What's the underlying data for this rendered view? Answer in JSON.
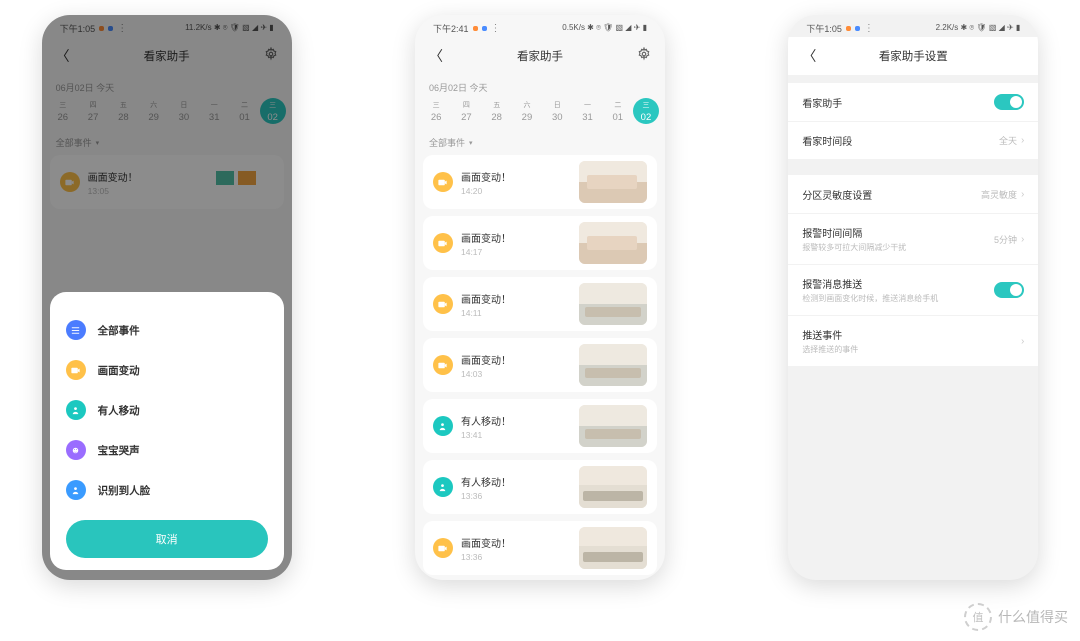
{
  "status": {
    "time_left": "下午1:05",
    "time_left2": "下午2:41",
    "net1": "11.2K/s ✱ ⌾ 🛡 ▧ ◢ ✈ ▮",
    "net2": "0.5K/s ✱ ⌾ 🛡 ▧ ◢ ✈ ▮",
    "net3": "2.2K/s ✱ ⌾ 🛡 ▧ ◢ ✈ ▮"
  },
  "titles": {
    "main": "看家助手",
    "settings": "看家助手设置"
  },
  "date": {
    "label": "06月02日 今天",
    "weekdays": [
      "三",
      "四",
      "五",
      "六",
      "日",
      "一",
      "二",
      "三"
    ],
    "days": [
      "26",
      "27",
      "28",
      "29",
      "30",
      "31",
      "01",
      "02"
    ]
  },
  "filter_label": "全部事件",
  "filter_options": {
    "all": "全部事件",
    "change": "画面变动",
    "person": "有人移动",
    "baby": "宝宝哭声",
    "face": "识别到人脸"
  },
  "cancel_label": "取消",
  "screen1_event": {
    "title": "画面变动！",
    "time": "13:05"
  },
  "events": [
    {
      "title": "画面变动！",
      "time": "14:20",
      "icon": "yellow",
      "thumb": "a"
    },
    {
      "title": "画面变动！",
      "time": "14:17",
      "icon": "yellow",
      "thumb": "a"
    },
    {
      "title": "画面变动！",
      "time": "14:11",
      "icon": "yellow",
      "thumb": "b"
    },
    {
      "title": "画面变动！",
      "time": "14:03",
      "icon": "yellow",
      "thumb": "b"
    },
    {
      "title": "有人移动！",
      "time": "13:41",
      "icon": "teal",
      "thumb": "b"
    },
    {
      "title": "有人移动！",
      "time": "13:36",
      "icon": "teal",
      "thumb": "c"
    },
    {
      "title": "画面变动！",
      "time": "13:36",
      "icon": "yellow",
      "thumb": "c"
    }
  ],
  "settings": {
    "enable": {
      "label": "看家助手"
    },
    "period": {
      "label": "看家时间段",
      "value": "全天"
    },
    "sensitivity": {
      "label": "分区灵敏度设置",
      "value": "高灵敏度"
    },
    "interval": {
      "label": "报警时间间隔",
      "sub": "报警较多可拉大间隔减少干扰",
      "value": "5分钟"
    },
    "push": {
      "label": "报警消息推送",
      "sub": "检测到画面变化时候，推送消息给手机"
    },
    "push_events": {
      "label": "推送事件",
      "sub": "选择推送的事件"
    }
  },
  "watermark": "什么值得买"
}
